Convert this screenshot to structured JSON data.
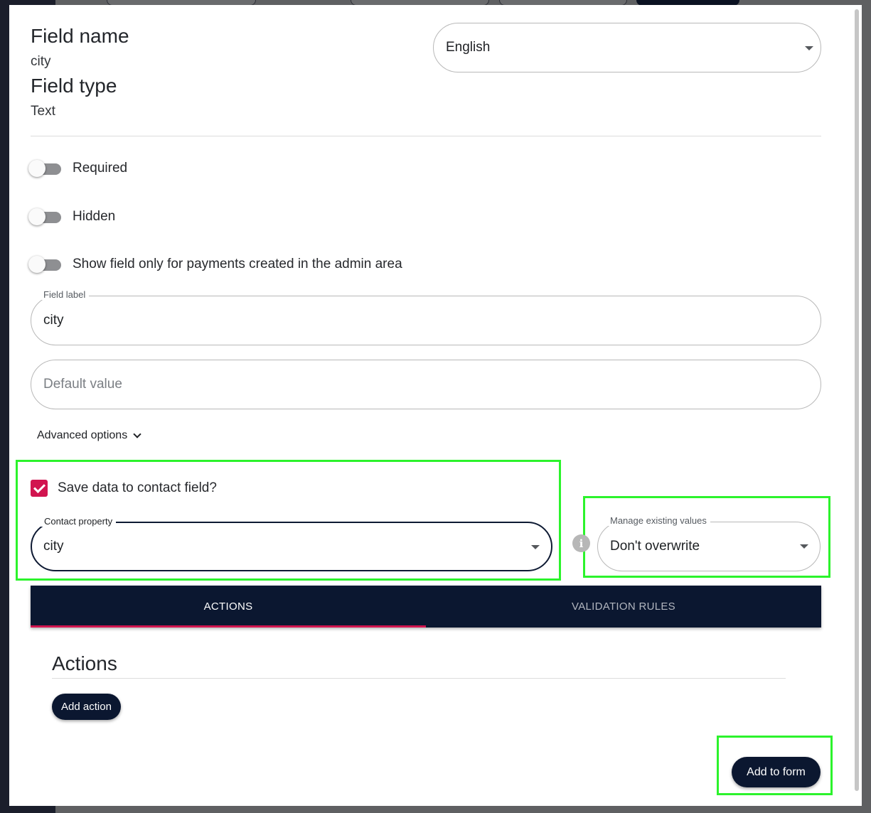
{
  "form": {
    "field_name_heading": "Field name",
    "field_name_value": "city",
    "field_type_heading": "Field type",
    "field_type_value": "Text",
    "language_select_value": "English",
    "toggles": {
      "required": "Required",
      "hidden": "Hidden",
      "admin_only": "Show field only for payments created in the admin area"
    },
    "field_label": {
      "label": "Field label",
      "value": "city"
    },
    "default_value": {
      "placeholder": "Default value"
    },
    "advanced_options_label": "Advanced options",
    "save_to_contact": {
      "label": "Save data to contact field?",
      "checked": true
    },
    "contact_property": {
      "label": "Contact property",
      "value": "city"
    },
    "manage_existing": {
      "label": "Manage existing values",
      "value": "Don't overwrite"
    }
  },
  "tabs": {
    "actions": "ACTIONS",
    "validation_rules": "VALIDATION RULES",
    "active": "ACTIONS"
  },
  "actions_section": {
    "title": "Actions",
    "add_action_label": "Add action"
  },
  "footer": {
    "add_to_form_label": "Add to form"
  },
  "colors": {
    "accent": "#d1144f",
    "navy": "#0b1730",
    "highlight": "#2cf32c"
  }
}
